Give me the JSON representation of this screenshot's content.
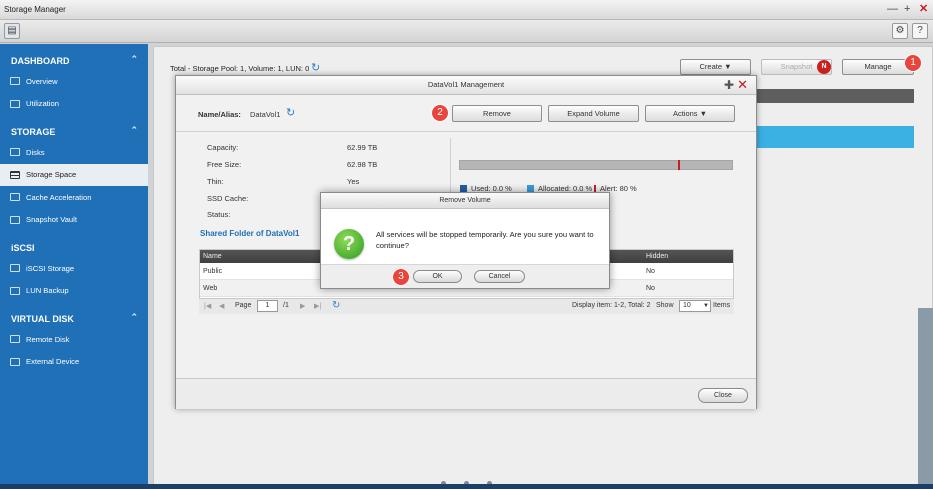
{
  "window": {
    "title": "Storage Manager"
  },
  "toolbar": {
    "settings_icon": "gear-icon",
    "help_label": "?"
  },
  "sidebar": {
    "sections": [
      {
        "label": "DASHBOARD",
        "items": [
          {
            "label": "Overview"
          },
          {
            "label": "Utilization"
          }
        ]
      },
      {
        "label": "STORAGE",
        "items": [
          {
            "label": "Disks"
          },
          {
            "label": "Storage Space"
          },
          {
            "label": "Cache Acceleration"
          },
          {
            "label": "Snapshot Vault"
          }
        ]
      },
      {
        "label": "iSCSI",
        "items": [
          {
            "label": "iSCSI Storage"
          },
          {
            "label": "LUN Backup"
          }
        ]
      },
      {
        "label": "VIRTUAL DISK",
        "items": [
          {
            "label": "Remote Disk"
          },
          {
            "label": "External Device"
          }
        ]
      }
    ],
    "active_item": "Storage Space"
  },
  "main": {
    "summary": "Total - Storage Pool: 1, Volume: 1, LUN: 0",
    "create_label": "Create",
    "snapshot_label": "Snapshot",
    "snapshot_badge": "N",
    "manage_label": "Manage"
  },
  "steps": {
    "s1": "1",
    "s2": "2",
    "s3": "3"
  },
  "manage_dialog": {
    "title": "DataVol1 Management",
    "name_label": "Name/Alias:",
    "name_value": "DataVol1",
    "remove_label": "Remove",
    "expand_label": "Expand Volume",
    "actions_label": "Actions",
    "details": [
      {
        "label": "Capacity:",
        "value": "62.99 TB"
      },
      {
        "label": "Free Size:",
        "value": "62.98 TB"
      },
      {
        "label": "Thin:",
        "value": "Yes"
      },
      {
        "label": "SSD Cache:",
        "value": ""
      },
      {
        "label": "Status:",
        "value": ""
      }
    ],
    "usage": {
      "used_label": "Used: 0.0 %",
      "allocated_label": "Allocated: 0.0 %",
      "alert_label": "Alert: 80 %",
      "used_fraction": 0.0,
      "allocated_fraction": 0.0,
      "alert_fraction": 0.8,
      "colors": {
        "used": "#1f5fa8",
        "allocated": "#3a9bd9",
        "alert": "#c51f1f"
      }
    },
    "shared_folder_title": "Shared Folder of DataVol1",
    "table": {
      "columns": [
        "Name",
        "Hidden"
      ],
      "rows": [
        [
          "Public",
          "No"
        ],
        [
          "Web",
          "No"
        ]
      ]
    },
    "pager": {
      "page_label": "Page",
      "page_value": "1",
      "page_total": "/1",
      "display_text": "Display item: 1-2, Total: 2",
      "show_label": "Show",
      "show_value": "10",
      "items_label": "Items"
    },
    "close_label": "Close"
  },
  "confirm_dialog": {
    "title": "Remove Volume",
    "message": "All services will be stopped temporarily. Are you sure you want to continue?",
    "ok_label": "OK",
    "cancel_label": "Cancel"
  }
}
